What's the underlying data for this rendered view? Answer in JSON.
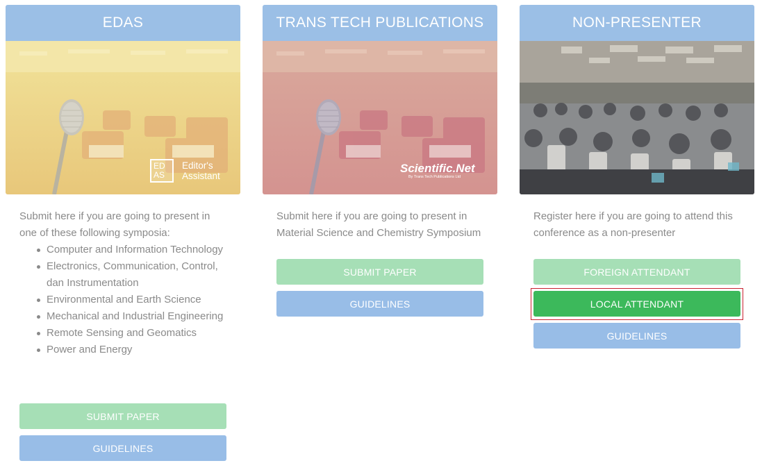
{
  "cards": [
    {
      "title": "EDAS",
      "image_logo": "EDAS Editor's Assistant",
      "logo_box_line1": "ED",
      "logo_box_line2": "AS",
      "logo_text_line1": "Editor's",
      "logo_text_line2": "Assistant",
      "description": "Submit here if you are going to present in one of these following symposia:",
      "topics": [
        "Computer and Information Technology",
        "Electronics, Communication, Control, dan Instrumentation",
        "Environmental and Earth Science",
        "Mechanical and Industrial Engineering",
        "Remote Sensing and Geomatics",
        "Power and Energy"
      ],
      "buttons": [
        {
          "label": "SUBMIT PAPER",
          "color": "#a6dfb6"
        },
        {
          "label": "GUIDELINES",
          "color": "#98bde7"
        }
      ]
    },
    {
      "title": "TRANS TECH PUBLICATIONS",
      "logo_main": "Scientific.Net",
      "logo_sub": "By Trans Tech Publications Ltd",
      "description": "Submit here if you are going to present in Material Science and Chemistry Symposium",
      "buttons": [
        {
          "label": "SUBMIT PAPER",
          "color": "#a6dfb6"
        },
        {
          "label": "GUIDELINES",
          "color": "#98bde7"
        }
      ]
    },
    {
      "title": "NON-PRESENTER",
      "description": "Register here if you are going to attend this conference as a non-presenter",
      "buttons": [
        {
          "label": "FOREIGN ATTENDANT",
          "color": "#a6dfb6"
        },
        {
          "label": "LOCAL ATTENDANT",
          "color": "#3cb95b",
          "highlighted": true
        },
        {
          "label": "GUIDELINES",
          "color": "#98bde7"
        }
      ]
    }
  ],
  "colors": {
    "header_blue": "#9bbfe6",
    "text_gray": "#8a8a8a",
    "highlight_red": "#c9212f"
  }
}
